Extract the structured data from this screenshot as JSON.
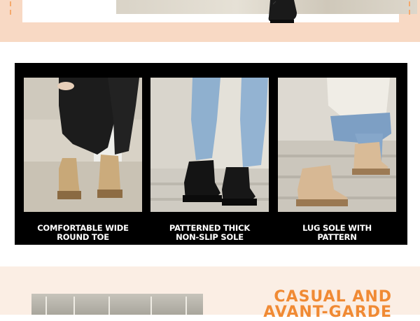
{
  "colors": {
    "peach_band": "#f8d9c4",
    "strip_background": "#000000",
    "caption_text": "#ffffff",
    "accent_orange": "#f08a34",
    "bottom_band": "#fbeee4"
  },
  "features": [
    {
      "caption": "COMFORTABLE WIDE\nROUND TOE",
      "icon": "tan-chelsea-boot-photo"
    },
    {
      "caption": "PATTERNED THICK\nNON-SLIP SOLE",
      "icon": "black-chelsea-boot-photo"
    },
    {
      "caption": "LUG SOLE WITH\nPATTERN",
      "icon": "beige-chelsea-boot-photo"
    }
  ],
  "promo": {
    "headline": "CASUAL AND\nAVANT-GARDE"
  }
}
